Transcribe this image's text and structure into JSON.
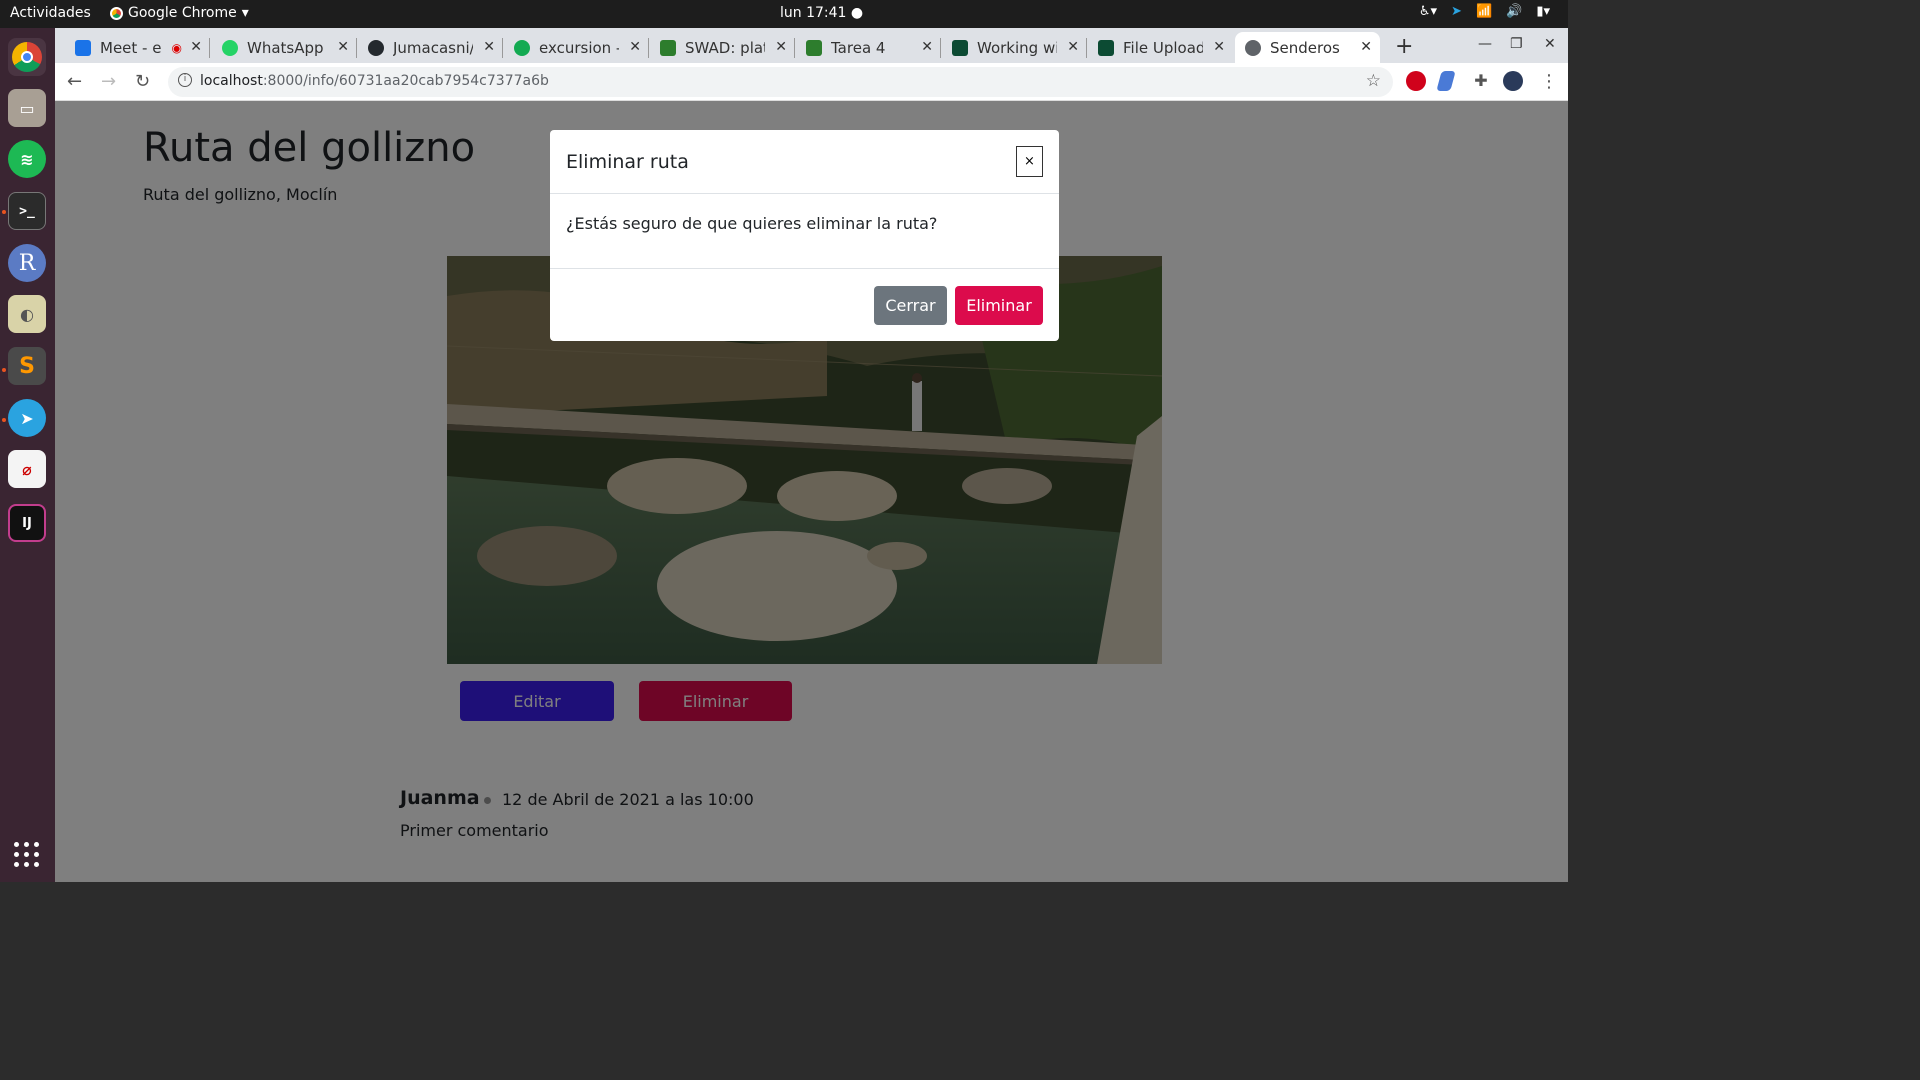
{
  "system": {
    "activities": "Actividades",
    "app_menu": "Google Chrome",
    "clock": "lun 17:41"
  },
  "browser": {
    "tabs": [
      {
        "title": "Meet - e",
        "color": "#1a73e8"
      },
      {
        "title": "WhatsApp",
        "color": "#25d366"
      },
      {
        "title": "Jumacasni/",
        "color": "#24292e"
      },
      {
        "title": "excursion - ",
        "color": "#13aa52"
      },
      {
        "title": "SWAD: plat",
        "color": "#2d7d2d"
      },
      {
        "title": "Tarea 4",
        "color": "#2d7d2d"
      },
      {
        "title": "Working wi",
        "color": "#0c4b33"
      },
      {
        "title": "File Upload",
        "color": "#0c4b33"
      },
      {
        "title": "Senderos",
        "color": "#5f6368"
      }
    ],
    "url_host": "localhost",
    "url_path": ":8000/info/60731aa20cab7954c7377a6b"
  },
  "page": {
    "title": "Ruta del gollizno",
    "subtitle": "Ruta del gollizno, Moclín",
    "edit_button": "Editar",
    "delete_button": "Eliminar",
    "comment": {
      "user": "Juanma",
      "date": "12 de Abril de 2021 a las 10:00",
      "text": "Primer comentario"
    }
  },
  "modal": {
    "title": "Eliminar ruta",
    "close_glyph": "×",
    "body": "¿Estás seguro de que quieres eliminar la ruta?",
    "cancel_button": "Cerrar",
    "confirm_button": "Eliminar"
  },
  "colors": {
    "primary": "#3d1ff0",
    "danger": "#dc0b4c",
    "secondary": "#6c757d"
  }
}
